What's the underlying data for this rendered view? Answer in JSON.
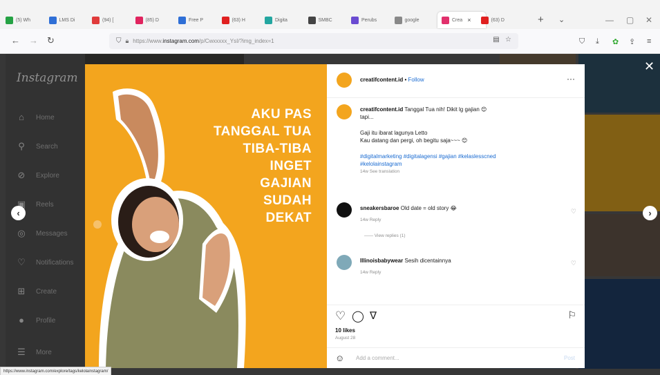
{
  "browser": {
    "tabs": [
      {
        "label": "(5) Wh",
        "color": "#25a244"
      },
      {
        "label": "LMS Di",
        "color": "#2f6fd6"
      },
      {
        "label": "(94) [",
        "color": "#e03b3b"
      },
      {
        "label": "(85) D",
        "color": "#e0245e"
      },
      {
        "label": "Free P",
        "color": "#2f6fd6"
      },
      {
        "label": "(63) H",
        "color": "#e02020"
      },
      {
        "label": "Digita",
        "color": "#23a6a0"
      },
      {
        "label": "SMBC",
        "color": "#444444"
      },
      {
        "label": "Perubs",
        "color": "#6a4bd1"
      },
      {
        "label": "google",
        "color": "#888888"
      },
      {
        "label": "Crea",
        "color": "#e1306c",
        "active": true
      },
      {
        "label": "(63) D",
        "color": "#e02020"
      }
    ],
    "url_prefix": "https://www.",
    "url_domain": "instagram.com",
    "url_path": "/p/Cwxxxxx_YsI/?img_index=1"
  },
  "sidebar": {
    "logo": "Instagram",
    "items": [
      {
        "label": "Home",
        "icon": "home-icon",
        "glyph": "⌂"
      },
      {
        "label": "Search",
        "icon": "search-icon",
        "glyph": "⚲"
      },
      {
        "label": "Explore",
        "icon": "explore-icon",
        "glyph": "⊘"
      },
      {
        "label": "Reels",
        "icon": "reels-icon",
        "glyph": "▣"
      },
      {
        "label": "Messages",
        "icon": "messages-icon",
        "glyph": "◎"
      },
      {
        "label": "Notifications",
        "icon": "heart-icon",
        "glyph": "♡"
      },
      {
        "label": "Create",
        "icon": "create-icon",
        "glyph": "⊞"
      },
      {
        "label": "Profile",
        "icon": "profile-icon",
        "glyph": "●"
      },
      {
        "label": "More",
        "icon": "menu-icon",
        "glyph": "☰"
      }
    ]
  },
  "post": {
    "headline_lines": [
      "AKU PAS",
      "TANGGAL TUA",
      "TIBA-TIBA",
      "INGET",
      "GAJIAN",
      "SUDAH",
      "DEKAT"
    ],
    "author": "creatifcontent.id",
    "separator": "•",
    "follow": "Follow",
    "more": "···",
    "caption_user": "creatifcontent.id",
    "caption_text": "Tanggal Tua nih! Dikit lg gajian 😊",
    "caption_line2": "tapi...",
    "caption_line3": "Gaji itu ibarat lagunya Letto",
    "caption_line4": "Kau datang dan pergi, oh begitu saja~~~ 😊",
    "hashtags_1": "#digitalmarketing #digitalagensi #gajian #kelaslesscned",
    "hashtags_2": "#kelolainstagram",
    "caption_meta": "14w   See translation",
    "comments": [
      {
        "user": "sneakersbaroe",
        "text": "Old date = old story 😂",
        "meta": "14w   Reply",
        "view_replies": "——   View replies (1)"
      },
      {
        "user": "Illinoisbabywear",
        "text": "Sesih dicentainnya",
        "meta": "14w   Reply"
      }
    ],
    "likes": "10 likes",
    "date": "August 28",
    "comment_placeholder": "Add a comment...",
    "post_label": "Post"
  },
  "status_url": "https://www.instagram.com/explore/tags/kelolainstagram/"
}
